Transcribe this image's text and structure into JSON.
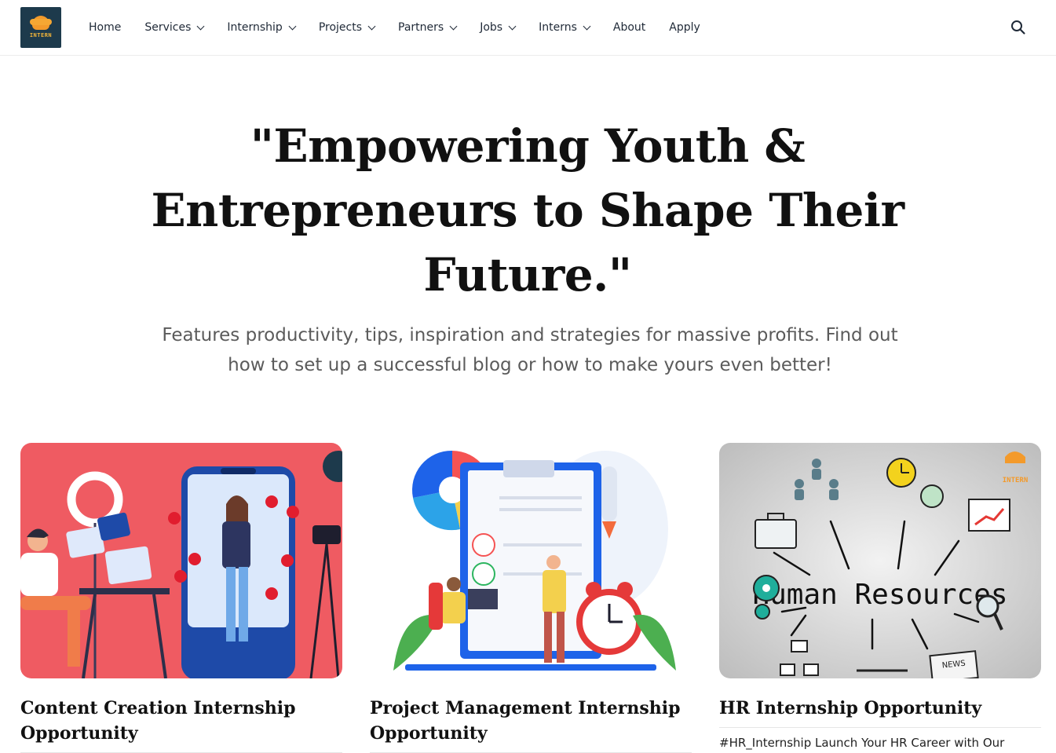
{
  "brand": {
    "logo_text": "INTERN"
  },
  "nav": {
    "items": [
      {
        "label": "Home",
        "dropdown": false
      },
      {
        "label": "Services",
        "dropdown": true
      },
      {
        "label": "Internship",
        "dropdown": true
      },
      {
        "label": "Projects",
        "dropdown": true
      },
      {
        "label": "Partners",
        "dropdown": true
      },
      {
        "label": "Jobs",
        "dropdown": true
      },
      {
        "label": "Interns",
        "dropdown": true
      },
      {
        "label": "About",
        "dropdown": false
      },
      {
        "label": "Apply",
        "dropdown": false
      }
    ],
    "search_icon": "search-icon"
  },
  "hero": {
    "title": "\"Empowering Youth & Entrepreneurs to Shape Their Future.\"",
    "subtitle": "Features productivity, tips, inspiration and strategies for massive profits. Find out how to set up a successful blog or how to make yours even better!"
  },
  "cards": [
    {
      "title": "Content Creation Internship Opportunity",
      "excerpt": ""
    },
    {
      "title": "Project Management Internship Opportunity",
      "excerpt": ""
    },
    {
      "title": "HR Internship Opportunity",
      "excerpt": "#HR_Internship Launch Your HR Career with Our"
    }
  ],
  "images": {
    "card_3_board_text": "Human Resources",
    "card_3_news_text": "NEWS",
    "card_3_logo_text": "INTERN"
  },
  "colors": {
    "logo_bg": "#1d3a4c",
    "logo_accent": "#f39a2b",
    "card1_bg": "#ef5b62",
    "card2_accent": "#1e63e9",
    "card3_bg": "#d7d7d7"
  }
}
